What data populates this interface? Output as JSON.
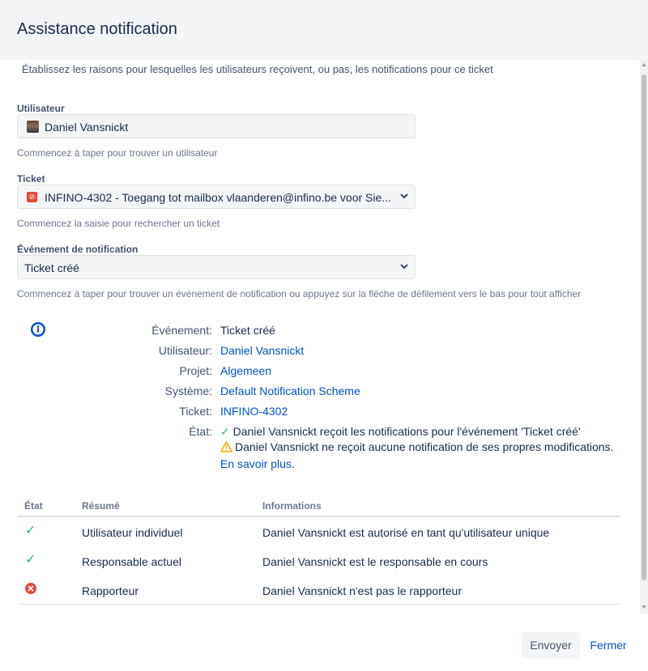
{
  "dialog": {
    "title": "Assistance notification"
  },
  "intro": "Établissez les raisons pour lesquelles les utilisateurs reçoivent, ou pas, les notifications pour ce ticket",
  "user_field": {
    "label": "Utilisateur",
    "value": "Daniel Vansnickt",
    "hint": "Commencez à taper pour trouver un utilisateur"
  },
  "ticket_field": {
    "label": "Ticket",
    "value": "INFINO-4302 - Toegang tot mailbox vlaanderen@infino.be voor Sie...",
    "hint": "Commencez la saisie pour rechercher un ticket"
  },
  "event_field": {
    "label": "Événement de notification",
    "value": "Ticket créé",
    "hint": "Commencez à taper pour trouver un événement de notification ou appuyez sur la flèche de défilement vers le bas pour tout afficher"
  },
  "details": {
    "event_label": "Événement:",
    "event_value": "Ticket créé",
    "user_label": "Utilisateur:",
    "user_value": "Daniel Vansnickt",
    "project_label": "Projet:",
    "project_value": "Algemeen",
    "scheme_label": "Système:",
    "scheme_value": "Default Notification Scheme",
    "ticket_label": "Ticket:",
    "ticket_value": "INFINO-4302",
    "state_label": "État:",
    "state_ok": "Daniel Vansnickt reçoit les notifications pour l'événement 'Ticket créé'",
    "state_warn": "Daniel Vansnickt ne reçoit aucune notification de ses propres modifications.",
    "learn_more": "En savoir plus",
    "learn_more_suffix": "."
  },
  "table": {
    "headers": {
      "state": "État",
      "summary": "Résumé",
      "info": "Informations"
    },
    "rows": [
      {
        "status": "ok",
        "summary": "Utilisateur individuel",
        "info": "Daniel Vansnickt est autorisé en tant qu'utilisateur unique"
      },
      {
        "status": "ok",
        "summary": "Responsable actuel",
        "info": "Daniel Vansnickt est le responsable en cours"
      },
      {
        "status": "error",
        "summary": "Rapporteur",
        "info": "Daniel Vansnickt n'est pas le rapporteur"
      }
    ]
  },
  "footer": {
    "send": "Envoyer",
    "close": "Fermer"
  },
  "colors": {
    "link": "#0052cc",
    "success": "#36b37e",
    "warning": "#ffab00",
    "error": "#e5493a",
    "info": "#0052cc"
  }
}
